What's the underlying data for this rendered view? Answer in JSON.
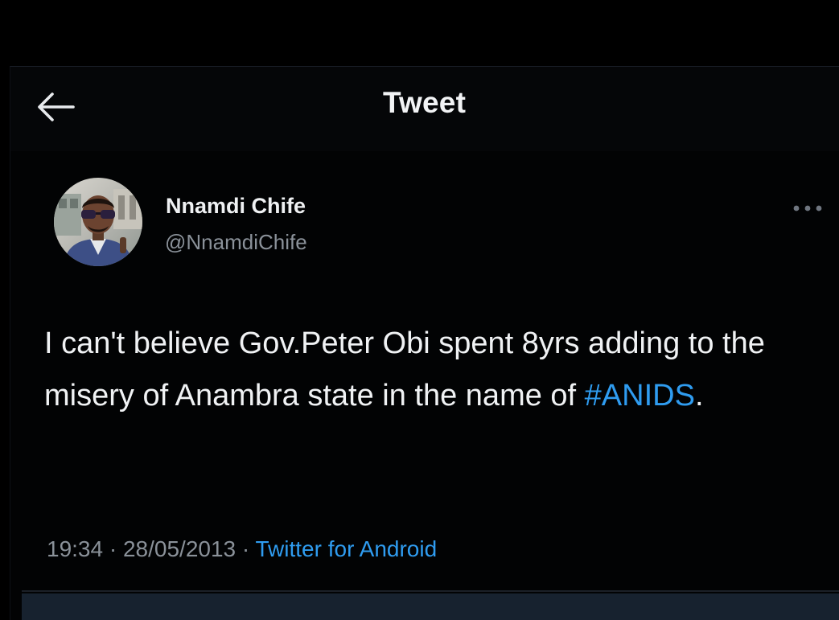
{
  "header": {
    "back_icon": "arrow-left-icon",
    "title": "Tweet"
  },
  "author": {
    "display_name": "Nnamdi Chife",
    "handle": "@NnamdiChife",
    "avatar": "profile-photo"
  },
  "more_icon": "more-horizontal-icon",
  "tweet": {
    "text_before": "I can't believe Gov.Peter Obi spent 8yrs adding to the misery of Anambra state in the name of ",
    "hashtag": "#ANIDS",
    "text_after": "."
  },
  "meta": {
    "time": "19:34",
    "separator_1": " · ",
    "date": "28/05/2013",
    "separator_2": " · ",
    "source": "Twitter for Android"
  },
  "colors": {
    "background": "#000000",
    "text": "#f0f2f4",
    "secondary_text": "#8a9199",
    "link": "#2f9cf0"
  }
}
